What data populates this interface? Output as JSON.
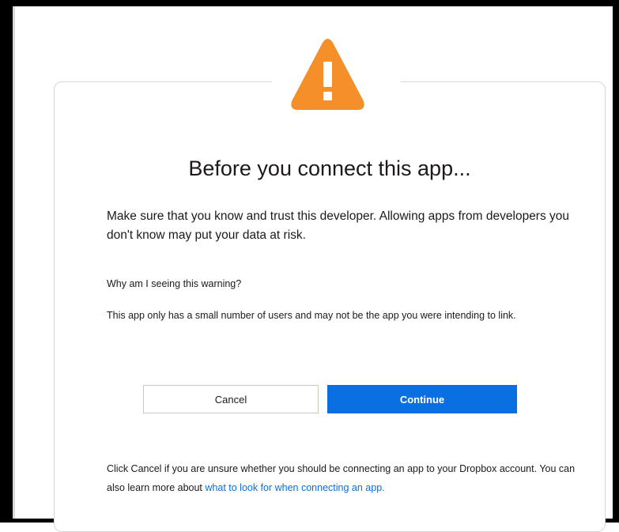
{
  "dialog": {
    "icon": "warning-triangle-icon",
    "title": "Before you connect this app...",
    "lead": "Make sure that you know and trust this developer. Allowing apps from developers you don't know may put your data at risk.",
    "why_heading": "Why am I seeing this warning?",
    "why_text": "This app only has a small number of users and may not be the app you were intending to link.",
    "buttons": {
      "cancel": "Cancel",
      "continue": "Continue"
    },
    "footer": {
      "text": "Click Cancel if you are unsure whether you should be connecting an app to your Dropbox account. You can also learn more about ",
      "link": "what to look for when connecting an app."
    }
  },
  "colors": {
    "warning": "#f58f29",
    "primary": "#0a6fe0",
    "text": "#1e1919"
  }
}
